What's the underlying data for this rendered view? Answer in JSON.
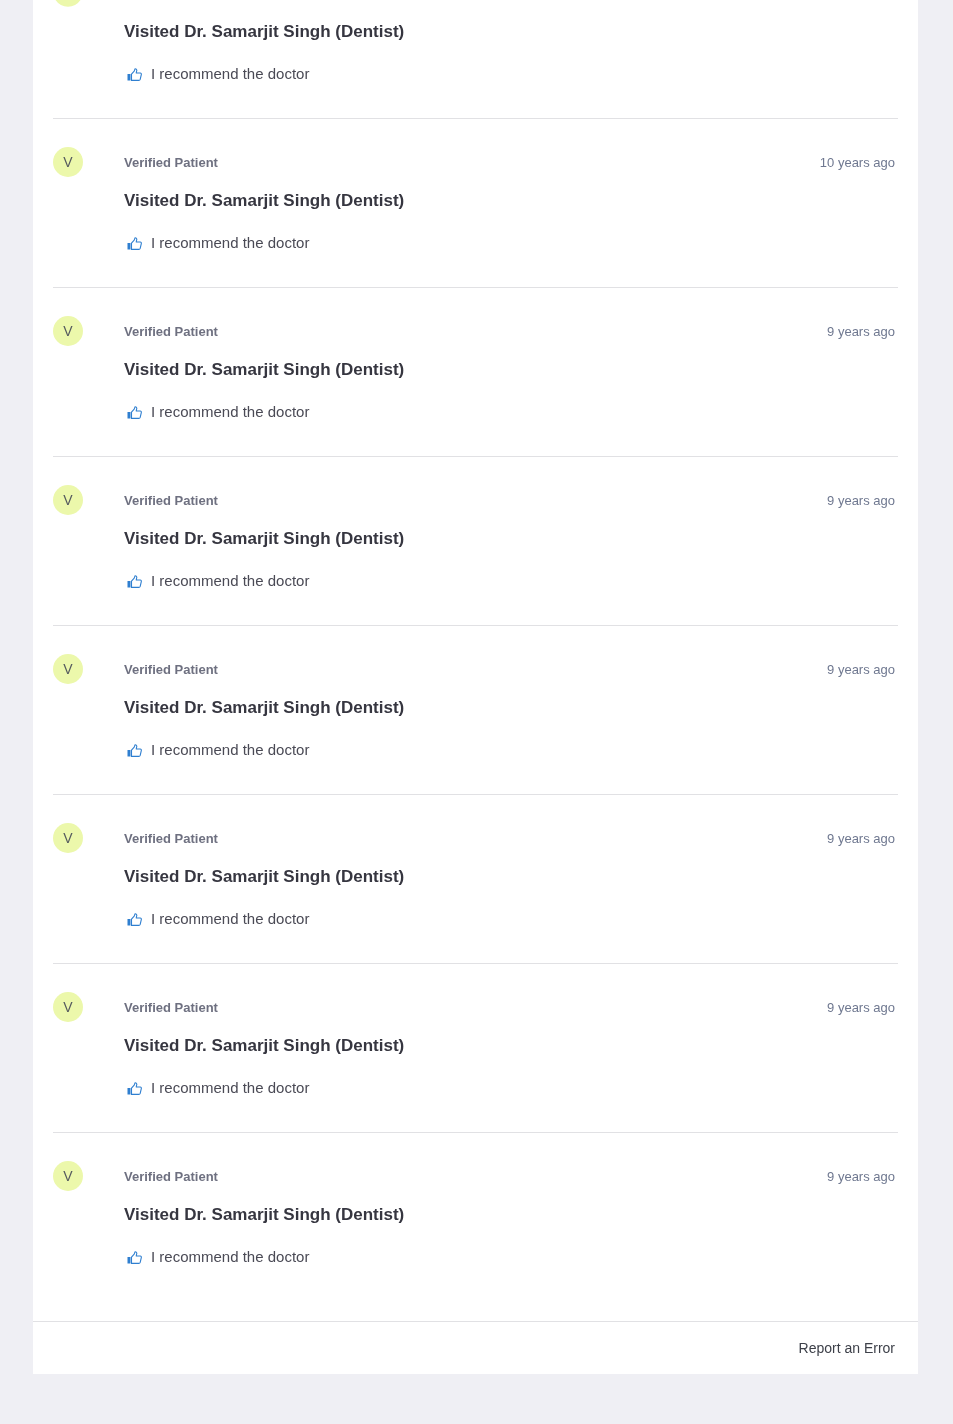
{
  "reviews": [
    {
      "kind": "partial",
      "title": "Visited Dr. Samarjit Singh (Dentist)",
      "recommendation": "I recommend the doctor"
    },
    {
      "kind": "full",
      "avatar_letter": "V",
      "author": "Verified Patient",
      "time": "10 years ago",
      "title": "Visited Dr. Samarjit Singh (Dentist)",
      "recommendation": "I recommend the doctor"
    },
    {
      "kind": "full",
      "avatar_letter": "V",
      "author": "Verified Patient",
      "time": "9 years ago",
      "title": "Visited Dr. Samarjit Singh (Dentist)",
      "recommendation": "I recommend the doctor"
    },
    {
      "kind": "full",
      "avatar_letter": "V",
      "author": "Verified Patient",
      "time": "9 years ago",
      "title": "Visited Dr. Samarjit Singh (Dentist)",
      "recommendation": "I recommend the doctor"
    },
    {
      "kind": "full",
      "avatar_letter": "V",
      "author": "Verified Patient",
      "time": "9 years ago",
      "title": "Visited Dr. Samarjit Singh (Dentist)",
      "recommendation": "I recommend the doctor"
    },
    {
      "kind": "full",
      "avatar_letter": "V",
      "author": "Verified Patient",
      "time": "9 years ago",
      "title": "Visited Dr. Samarjit Singh (Dentist)",
      "recommendation": "I recommend the doctor"
    },
    {
      "kind": "full",
      "avatar_letter": "V",
      "author": "Verified Patient",
      "time": "9 years ago",
      "title": "Visited Dr. Samarjit Singh (Dentist)",
      "recommendation": "I recommend the doctor"
    },
    {
      "kind": "full",
      "avatar_letter": "V",
      "author": "Verified Patient",
      "time": "9 years ago",
      "title": "Visited Dr. Samarjit Singh (Dentist)",
      "recommendation": "I recommend the doctor"
    }
  ],
  "footer": {
    "link": "Report an Error"
  }
}
